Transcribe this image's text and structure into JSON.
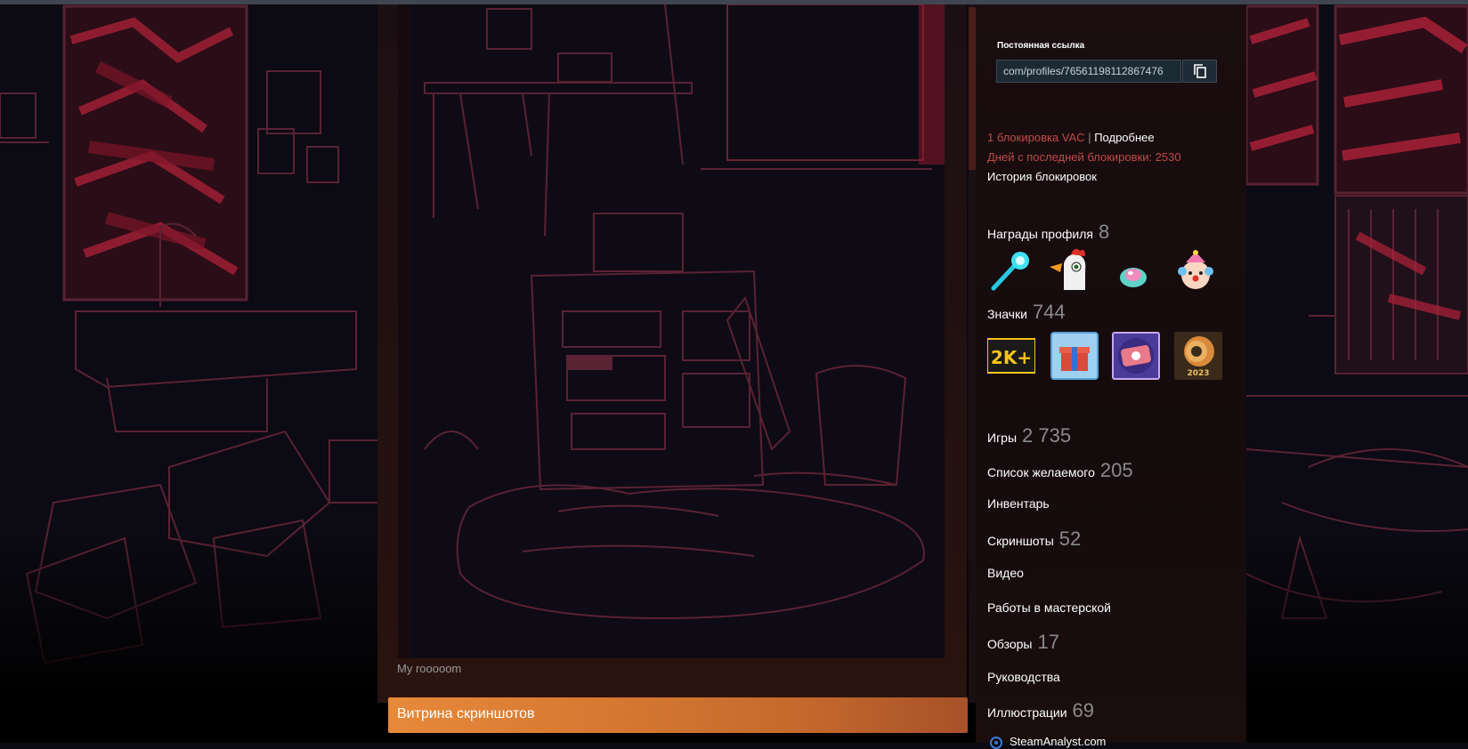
{
  "showcase": {
    "caption": "My rooooom",
    "section_title": "Витрина скриншотов"
  },
  "sidebar": {
    "permalink_title": "Постоянная ссылка",
    "permalink_value": "com/profiles/76561198112867476",
    "vac_count": "1 блокировка VAC",
    "vac_separator": "|",
    "vac_details": "Подробнее",
    "days_since_ban": "Дней с последней блокировки: 2530",
    "ban_history": "История блокировок",
    "awards_label": "Награды профиля",
    "awards_count": "8",
    "badges_label": "Значки",
    "badges_count": "744",
    "games_label": "Игры",
    "games_count": "2 735",
    "wishlist_label": "Список желаемого",
    "wishlist_count": "205",
    "inventory_label": "Инвентарь",
    "screenshots_label": "Скриншоты",
    "screenshots_count": "52",
    "videos_label": "Видео",
    "workshop_label": "Работы в мастерской",
    "reviews_label": "Обзоры",
    "reviews_count": "17",
    "guides_label": "Руководства",
    "artwork_label": "Иллюстрации",
    "artwork_count": "69",
    "external_link": "SteamAnalyst.com"
  },
  "colors": {
    "accent_orange": "#e7893a",
    "vac_red": "#c14a4a",
    "count_gray": "#8a8a8a",
    "scene_line": "#5a2233",
    "scene_red": "#b0223a"
  },
  "icons": {
    "copy": "copy-icon",
    "award_1": "comet-award-icon",
    "award_2": "chicken-award-icon",
    "award_3": "jelly-award-icon",
    "award_4": "clown-award-icon",
    "badge_1": "2k-badge-icon",
    "badge_2": "gift-badge-icon",
    "badge_3": "ticket-badge-icon",
    "badge_4": "steam-2023-badge-icon",
    "link": "external-link-icon"
  }
}
